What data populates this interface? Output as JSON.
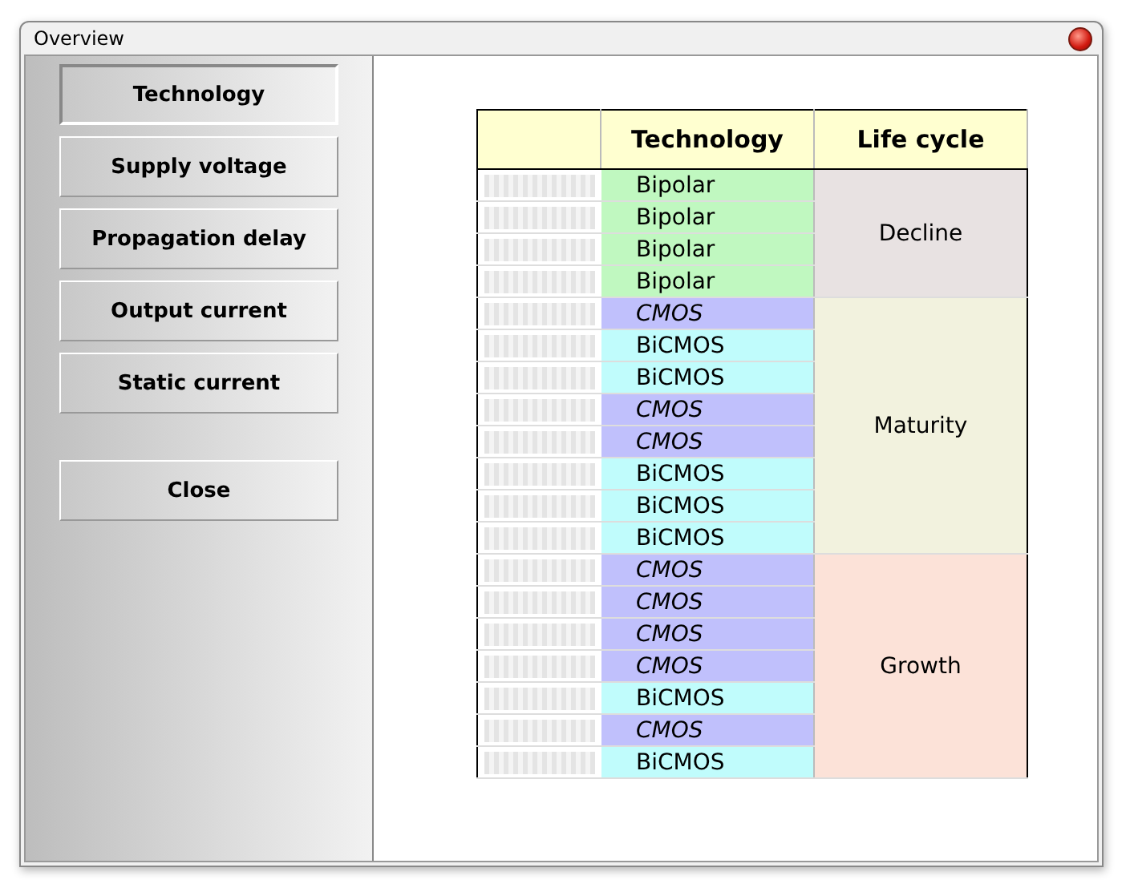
{
  "window": {
    "title": "Overview"
  },
  "sidebar": {
    "buttons": [
      {
        "label": "Technology",
        "selected": true
      },
      {
        "label": "Supply voltage",
        "selected": false
      },
      {
        "label": "Propagation delay",
        "selected": false
      },
      {
        "label": "Output current",
        "selected": false
      },
      {
        "label": "Static current",
        "selected": false
      }
    ],
    "close_button": "Close"
  },
  "table": {
    "columns": [
      "Technology",
      "Life cycle"
    ],
    "groups": [
      {
        "life_cycle": "Decline",
        "color": "#e8e2e2",
        "rows": [
          {
            "technology": "Bipolar",
            "kind": "bipolar"
          },
          {
            "technology": "Bipolar",
            "kind": "bipolar"
          },
          {
            "technology": "Bipolar",
            "kind": "bipolar"
          },
          {
            "technology": "Bipolar",
            "kind": "bipolar"
          }
        ]
      },
      {
        "life_cycle": "Maturity",
        "color": "#f2f2de",
        "rows": [
          {
            "technology": "CMOS",
            "kind": "cmos"
          },
          {
            "technology": "BiCMOS",
            "kind": "bicmos"
          },
          {
            "technology": "BiCMOS",
            "kind": "bicmos"
          },
          {
            "technology": "CMOS",
            "kind": "cmos"
          },
          {
            "technology": "CMOS",
            "kind": "cmos"
          },
          {
            "technology": "BiCMOS",
            "kind": "bicmos"
          },
          {
            "technology": "BiCMOS",
            "kind": "bicmos"
          },
          {
            "technology": "BiCMOS",
            "kind": "bicmos"
          }
        ]
      },
      {
        "life_cycle": "Growth",
        "color": "#fce2d8",
        "rows": [
          {
            "technology": "CMOS",
            "kind": "cmos"
          },
          {
            "technology": "CMOS",
            "kind": "cmos"
          },
          {
            "technology": "CMOS",
            "kind": "cmos"
          },
          {
            "technology": "CMOS",
            "kind": "cmos"
          },
          {
            "technology": "BiCMOS",
            "kind": "bicmos"
          },
          {
            "technology": "CMOS",
            "kind": "cmos"
          },
          {
            "technology": "BiCMOS",
            "kind": "bicmos"
          }
        ]
      }
    ]
  }
}
